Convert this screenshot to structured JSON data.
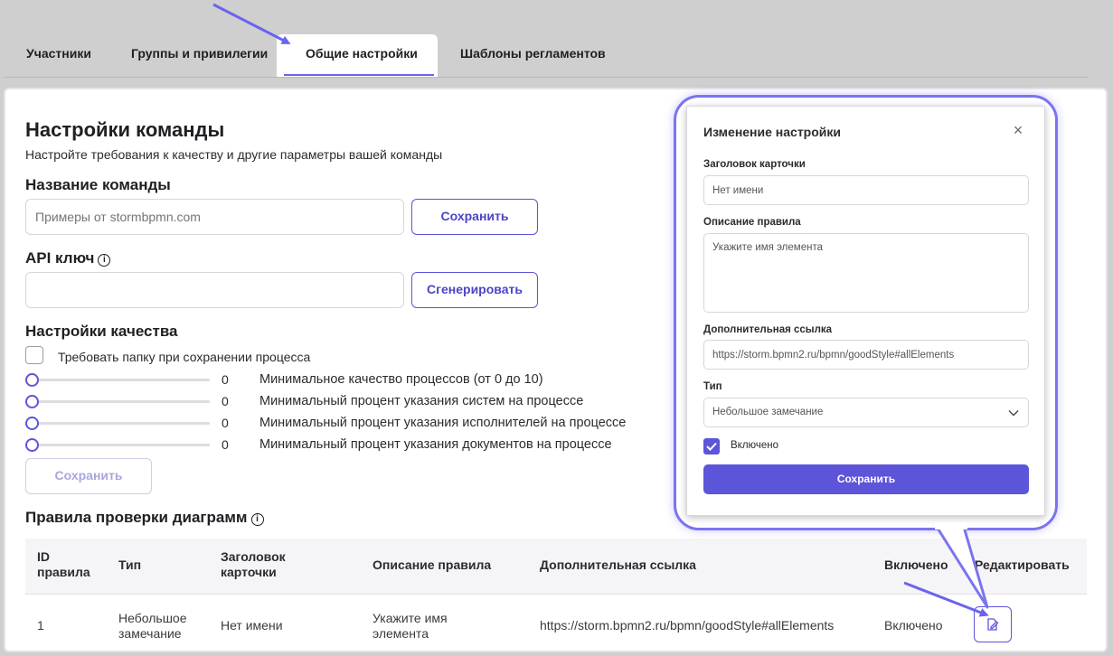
{
  "tabs": [
    {
      "label": "Участники"
    },
    {
      "label": "Группы и привилегии"
    },
    {
      "label": "Общие настройки"
    },
    {
      "label": "Шаблоны регламентов"
    }
  ],
  "page": {
    "title": "Настройки команды",
    "subtitle": "Настройте требования к качеству и другие параметры вашей команды"
  },
  "team_name": {
    "heading": "Название команды",
    "placeholder": "Примеры от stormbpmn.com",
    "save_label": "Сохранить"
  },
  "api_key": {
    "heading": "API ключ",
    "info": "i",
    "value": "",
    "generate_label": "Сгенерировать"
  },
  "quality": {
    "heading": "Настройки качества",
    "require_folder_label": "Требовать папку при сохранении процесса",
    "sliders": [
      {
        "value": "0",
        "label": "Минимальное качество процессов (от 0 до 10)"
      },
      {
        "value": "0",
        "label": "Минимальный процент указания систем на процессе"
      },
      {
        "value": "0",
        "label": "Минимальный процент указания исполнителей на процессе"
      },
      {
        "value": "0",
        "label": "Минимальный процент указания документов на процессе"
      }
    ],
    "save_label": "Сохранить"
  },
  "rules": {
    "heading": "Правила проверки диаграмм",
    "info": "i",
    "columns": {
      "id": "ID правила",
      "type": "Тип",
      "card_title": "Заголовок карточки",
      "description": "Описание правила",
      "link": "Дополнительная ссылка",
      "enabled": "Включено",
      "edit": "Редактировать"
    },
    "row": {
      "id": "1",
      "type": "Небольшое замечание",
      "card_title": "Нет имени",
      "description": "Укажите имя элемента",
      "link": "https://storm.bpmn2.ru/bpmn/goodStyle#allElements",
      "enabled": "Включено"
    }
  },
  "modal": {
    "title": "Изменение настройки",
    "close": "×",
    "card_title_label": "Заголовок карточки",
    "card_title_value": "Нет имени",
    "description_label": "Описание правила",
    "description_value": "Укажите имя элемента",
    "link_label": "Дополнительная ссылка",
    "link_value": "https://storm.bpmn2.ru/bpmn/goodStyle#allElements",
    "type_label": "Тип",
    "type_value": "Небольшое замечание",
    "enabled_label": "Включено",
    "enabled_checked": true,
    "save_label": "Сохранить"
  },
  "colors": {
    "accent": "#5d55d9",
    "highlight": "#7b74ee",
    "background": "#cfcfcf"
  }
}
